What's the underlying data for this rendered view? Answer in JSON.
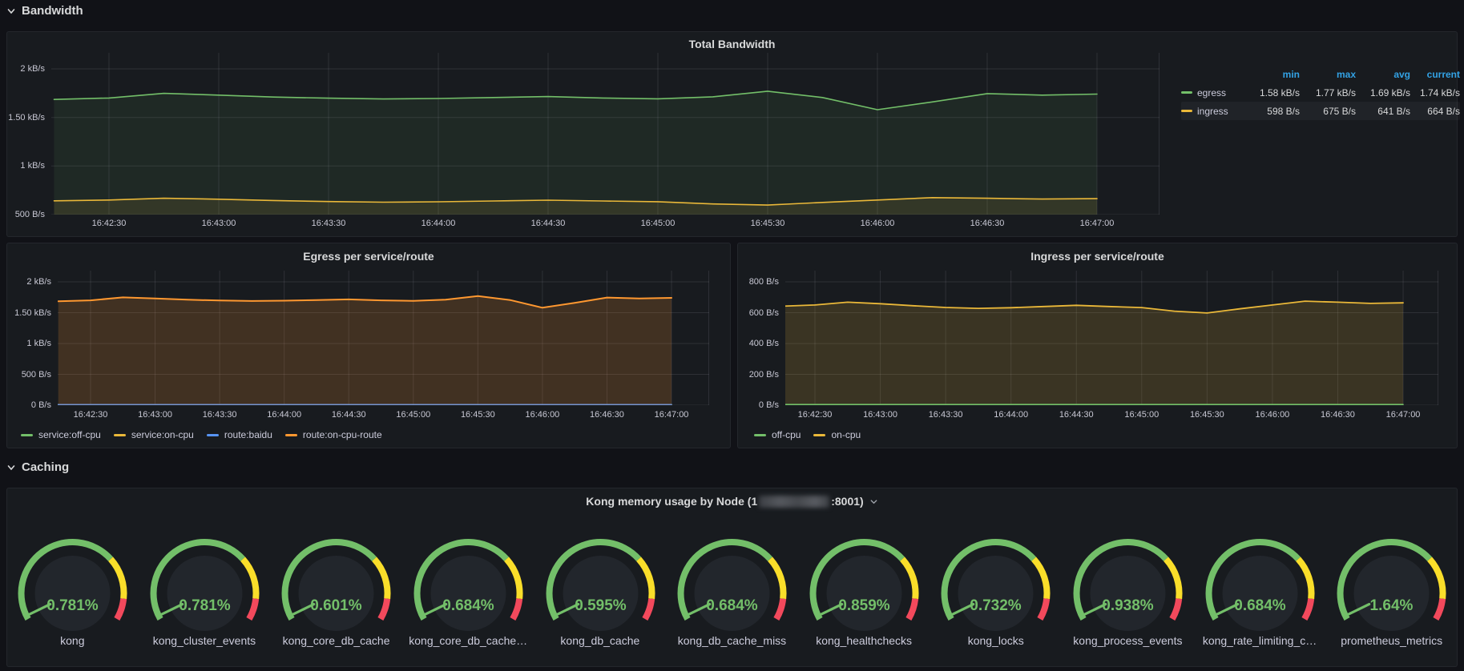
{
  "sections": {
    "bandwidth": {
      "label": "Bandwidth"
    },
    "caching": {
      "label": "Caching"
    }
  },
  "panels": {
    "total_bandwidth": {
      "title": "Total Bandwidth",
      "legend_table": {
        "headers": [
          "min",
          "max",
          "avg",
          "current"
        ],
        "rows": [
          {
            "name": "egress",
            "color": "#73bf69",
            "min": "1.58 kB/s",
            "max": "1.77 kB/s",
            "avg": "1.69 kB/s",
            "current": "1.74 kB/s"
          },
          {
            "name": "ingress",
            "color": "#eab839",
            "min": "598 B/s",
            "max": "675 B/s",
            "avg": "641 B/s",
            "current": "664 B/s"
          }
        ]
      }
    },
    "egress": {
      "title": "Egress per service/route",
      "legend": [
        {
          "label": "service:off-cpu",
          "color": "#73bf69"
        },
        {
          "label": "service:on-cpu",
          "color": "#eab839"
        },
        {
          "label": "route:baidu",
          "color": "#5794f2"
        },
        {
          "label": "route:on-cpu-route",
          "color": "#ff9830"
        }
      ]
    },
    "ingress": {
      "title": "Ingress per service/route",
      "legend": [
        {
          "label": "off-cpu",
          "color": "#73bf69"
        },
        {
          "label": "on-cpu",
          "color": "#eab839"
        }
      ]
    },
    "kong": {
      "title_prefix": "Kong memory usage by Node (1",
      "title_suffix": ":8001)",
      "redacted": true,
      "gauge_colors": {
        "green": "#73bf69",
        "yellow": "#fade2a",
        "red": "#f2495c"
      }
    }
  },
  "chart_data": [
    {
      "type": "line",
      "title": "Total Bandwidth",
      "unit": "B/s",
      "x_ticks": [
        "16:42:30",
        "16:43:00",
        "16:43:30",
        "16:44:00",
        "16:44:30",
        "16:45:00",
        "16:45:30",
        "16:46:00",
        "16:46:30",
        "16:47:00"
      ],
      "y_ticks": [
        {
          "label": "2 kB/s",
          "value": 2000
        },
        {
          "label": "1.50 kB/s",
          "value": 1500
        },
        {
          "label": "1 kB/s",
          "value": 1000
        },
        {
          "label": "500 B/s",
          "value": 500
        }
      ],
      "ylim": [
        500,
        2100
      ],
      "grid": true,
      "legend_position": "right-table",
      "start_offset_seconds": -15,
      "step_seconds": 15,
      "series": [
        {
          "name": "egress",
          "color": "#73bf69",
          "values": [
            1685,
            1700,
            1748,
            1730,
            1710,
            1698,
            1690,
            1695,
            1705,
            1715,
            1700,
            1692,
            1712,
            1770,
            1705,
            1580,
            1660,
            1745,
            1730,
            1740
          ]
        },
        {
          "name": "ingress",
          "color": "#eab839",
          "values": [
            642,
            650,
            668,
            658,
            645,
            634,
            628,
            632,
            640,
            648,
            640,
            633,
            610,
            598,
            625,
            650,
            675,
            668,
            660,
            664
          ]
        }
      ]
    },
    {
      "type": "area",
      "title": "Egress per service/route",
      "unit": "B/s",
      "stacked": true,
      "x_ticks": [
        "16:42:30",
        "16:43:00",
        "16:43:30",
        "16:44:00",
        "16:44:30",
        "16:45:00",
        "16:45:30",
        "16:46:00",
        "16:46:30",
        "16:47:00"
      ],
      "y_ticks": [
        {
          "label": "2 kB/s",
          "value": 2000
        },
        {
          "label": "1.50 kB/s",
          "value": 1500
        },
        {
          "label": "1 kB/s",
          "value": 1000
        },
        {
          "label": "500 B/s",
          "value": 500
        },
        {
          "label": "0 B/s",
          "value": 0
        }
      ],
      "ylim": [
        0,
        2200
      ],
      "grid": true,
      "legend_position": "bottom",
      "start_offset_seconds": -15,
      "step_seconds": 15,
      "series": [
        {
          "name": "service:off-cpu",
          "color": "#73bf69",
          "flat": 0
        },
        {
          "name": "service:on-cpu",
          "color": "#eab839",
          "flat": 0
        },
        {
          "name": "route:baidu",
          "color": "#5794f2",
          "flat": 0
        },
        {
          "name": "route:on-cpu-route",
          "color": "#ff9830",
          "values": [
            1685,
            1700,
            1748,
            1730,
            1710,
            1698,
            1690,
            1695,
            1705,
            1715,
            1700,
            1692,
            1712,
            1770,
            1705,
            1580,
            1660,
            1745,
            1730,
            1740
          ]
        }
      ]
    },
    {
      "type": "area",
      "title": "Ingress per service/route",
      "unit": "B/s",
      "x_ticks": [
        "16:42:30",
        "16:43:00",
        "16:43:30",
        "16:44:00",
        "16:44:30",
        "16:45:00",
        "16:45:30",
        "16:46:00",
        "16:46:30",
        "16:47:00"
      ],
      "y_ticks": [
        {
          "label": "800 B/s",
          "value": 800
        },
        {
          "label": "600 B/s",
          "value": 600
        },
        {
          "label": "400 B/s",
          "value": 400
        },
        {
          "label": "200 B/s",
          "value": 200
        },
        {
          "label": "0 B/s",
          "value": 0
        }
      ],
      "ylim": [
        0,
        880
      ],
      "grid": true,
      "legend_position": "bottom",
      "start_offset_seconds": -15,
      "step_seconds": 15,
      "series": [
        {
          "name": "on-cpu",
          "color": "#eab839",
          "values": [
            642,
            650,
            668,
            658,
            645,
            634,
            628,
            632,
            640,
            648,
            640,
            633,
            610,
            598,
            625,
            650,
            675,
            668,
            660,
            664
          ]
        },
        {
          "name": "off-cpu",
          "color": "#73bf69",
          "flat": 0
        }
      ]
    },
    {
      "type": "gauge",
      "title": "Kong memory usage by Node",
      "unit": "%",
      "min": 0,
      "max": 100,
      "thresholds": [
        {
          "color": "#73bf69",
          "from": 0
        },
        {
          "color": "#fade2a",
          "from": 70
        },
        {
          "color": "#f2495c",
          "from": 90
        }
      ],
      "values": [
        {
          "name": "kong",
          "value": 0.781,
          "display": "0.781%"
        },
        {
          "name": "kong_cluster_events",
          "value": 0.781,
          "display": "0.781%"
        },
        {
          "name": "kong_core_db_cache",
          "value": 0.601,
          "display": "0.601%"
        },
        {
          "name": "kong_core_db_cache…",
          "value": 0.684,
          "display": "0.684%"
        },
        {
          "name": "kong_db_cache",
          "value": 0.595,
          "display": "0.595%"
        },
        {
          "name": "kong_db_cache_miss",
          "value": 0.684,
          "display": "0.684%"
        },
        {
          "name": "kong_healthchecks",
          "value": 0.859,
          "display": "0.859%"
        },
        {
          "name": "kong_locks",
          "value": 0.732,
          "display": "0.732%"
        },
        {
          "name": "kong_process_events",
          "value": 0.938,
          "display": "0.938%"
        },
        {
          "name": "kong_rate_limiting_c…",
          "value": 0.684,
          "display": "0.684%"
        },
        {
          "name": "prometheus_metrics",
          "value": 1.64,
          "display": "1.64%"
        }
      ]
    }
  ]
}
